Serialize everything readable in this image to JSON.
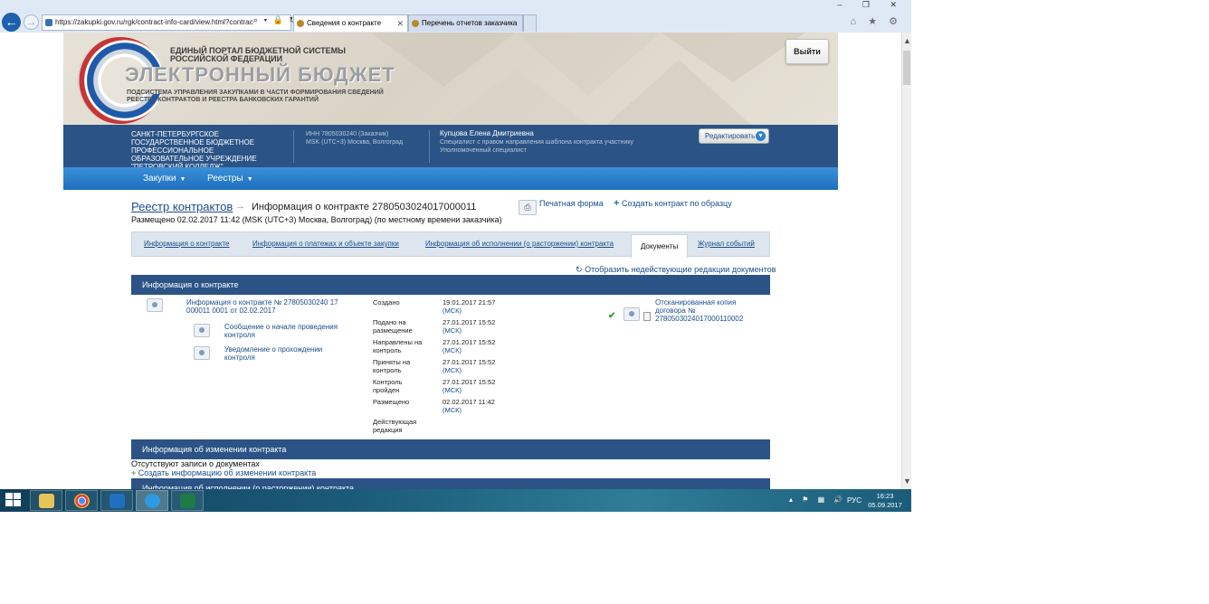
{
  "browser": {
    "url": "https://zakupki.gov.ru/rgk/contract-info-card/view.html?contrac",
    "address_icons": "⌕ ▾ 🔒 ↻",
    "tabs": [
      {
        "label": "Сведения о контракте"
      },
      {
        "label": "Перечень отчетов заказчика"
      }
    ],
    "window_controls": "– ❐ ✕",
    "toolbar_icons": "⌂ ★ ⚙"
  },
  "banner": {
    "top_line1": "ЕДИНЫЙ ПОРТАЛ БЮДЖЕТНОЙ СИСТЕМЫ",
    "top_line2": "РОССИЙСКОЙ ФЕДЕРАЦИИ",
    "title": "ЭЛЕКТРОННЫЙ БЮДЖЕТ",
    "subtitle": "ПОДСИСТЕМА УПРАВЛЕНИЯ ЗАКУПКАМИ В ЧАСТИ ФОРМИРОВАНИЯ СВЕДЕНИЙ РЕЕСТРА КОНТРАКТОВ И РЕЕСТРА БАНКОВСКИХ ГАРАНТИЙ",
    "logout": "Выйти"
  },
  "org": {
    "name": "САНКТ-ПЕТЕРБУРГСКОЕ ГОСУДАРСТВЕННОЕ БЮДЖЕТНОЕ ПРОФЕССИОНАЛЬНОЕ ОБРАЗОВАТЕЛЬНОЕ УЧРЕЖДЕНИЕ \"ПЕТРОВСКИЙ КОЛЛЕДЖ\"",
    "inn": "ИНН 7805030240 (Заказчик)",
    "tz": "MSK (UTC+3) Москва, Волгоград",
    "user_name": "Купцова Елена Дмитриевна",
    "user_role1": "Специалист с правом направления шаблона контракта участнику",
    "user_role2": "Уполномоченный специалист",
    "edit": "Редактировать"
  },
  "menu": {
    "items": [
      "Закупки",
      "Реестры"
    ]
  },
  "content": {
    "breadcrumb_link": "Реестр контрактов",
    "breadcrumb_current": "Информация о контракте 2780503024017000011",
    "print": "Печатная форма",
    "create_by_sample": "Создать контракт по образцу",
    "placed": "Размещено 02.02.2017 11:42 (MSK (UTC+3) Москва, Волгоград) (по местному времени заказчика)",
    "tabs": [
      {
        "label": "Информация о контракте"
      },
      {
        "label": "Информация о платежах и объекте закупки"
      },
      {
        "label": "Информация об исполнении (о расторжении) контракта"
      },
      {
        "label": "Документы"
      },
      {
        "label": "Журнал событий"
      }
    ],
    "show_inactive": "Отобразить недействующие редакции документов",
    "section1": "Информация о контракте",
    "doc_main": "Информация о контракте № 27805030240 17 000011 0001 от 02.02.2017",
    "doc_sub1": "Сообщение о начале проведения контроля",
    "doc_sub2": "Уведомление о прохождении контроля",
    "statuses": [
      {
        "label": "Создано",
        "date": "19.01.2017 21:57",
        "tz": "(МСК)"
      },
      {
        "label": "Подано на размещение",
        "date": "27.01.2017 15:52",
        "tz": "(МСК)"
      },
      {
        "label": "Направлены на контроль",
        "date": "27.01.2017 15:52",
        "tz": "(МСК)"
      },
      {
        "label": "Приняты на контроль",
        "date": "27.01.2017 15:52",
        "tz": "(МСК)"
      },
      {
        "label": "Контроль пройден",
        "date": "27.01.2017 15:52",
        "tz": "(МСК)"
      },
      {
        "label": "Размещено",
        "date": "02.02.2017 11:42",
        "tz": "(МСК)"
      },
      {
        "label": "Действующая редакция",
        "date": "",
        "tz": ""
      }
    ],
    "scan_copy": "Отсканированная копия договора № 2780503024017000110002",
    "section2": "Информация об изменении контракта",
    "no_records": "Отсутствуют записи о документах",
    "create_change": "Создать информацию об изменении контракта",
    "section3": "Информация об исполнении (о расторжении) контракта"
  },
  "taskbar": {
    "tray_icons": "▴ ⚑ ▦ 🔊",
    "lang": "РУС",
    "time": "16:23",
    "date": "05.09.2017"
  }
}
